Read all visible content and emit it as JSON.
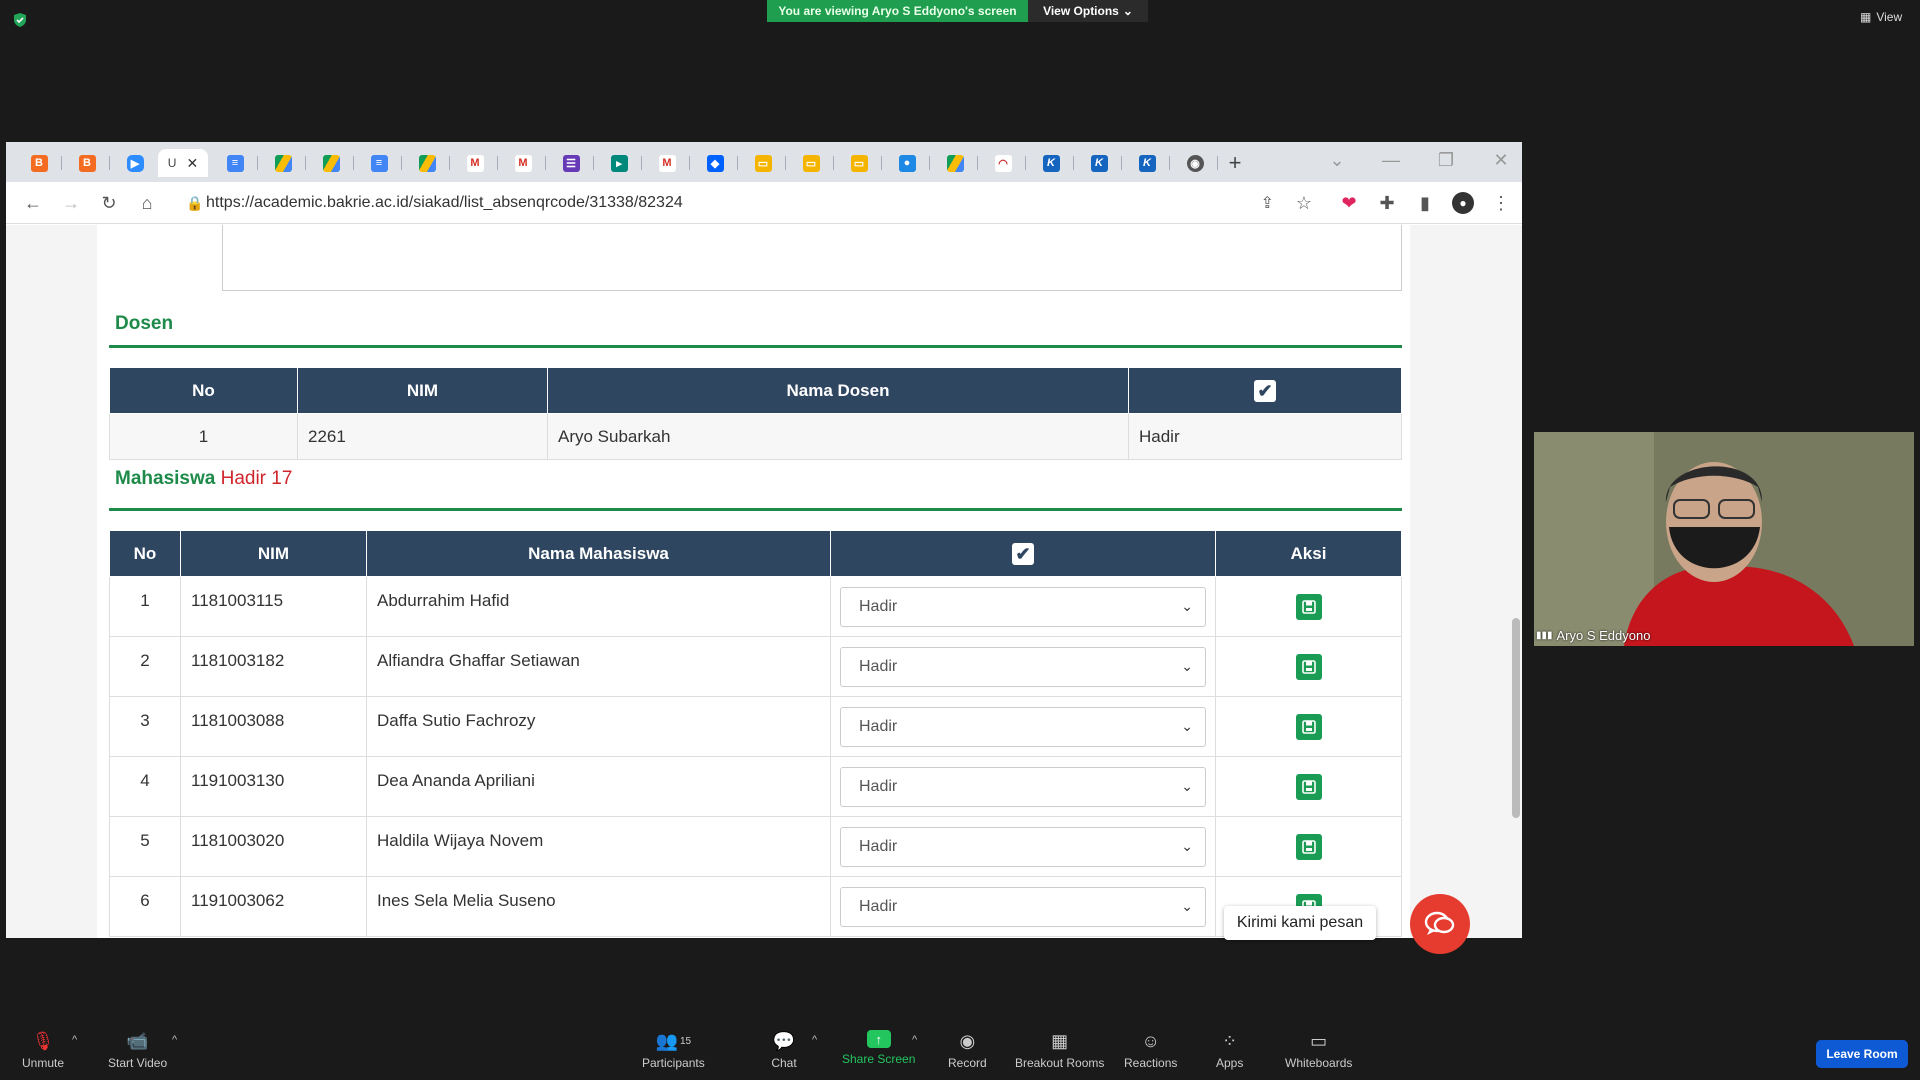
{
  "zoom": {
    "banner": "You are viewing Aryo S Eddyono's screen",
    "view_options": "View Options",
    "view_label": "View",
    "participant_name": "Aryo S Eddyono",
    "participants_count": "15",
    "controls": [
      "Unmute",
      "Start Video",
      "Participants",
      "Chat",
      "Share Screen",
      "Record",
      "Breakout Rooms",
      "Reactions",
      "Apps",
      "Whiteboards"
    ],
    "leave": "Leave Room"
  },
  "browser": {
    "url": "https://academic.bakrie.ac.id/siakad/list_absenqrcode/31338/82324",
    "tab_favicons": [
      "brave",
      "brave",
      "zoom",
      "blank",
      "docs",
      "drive",
      "drive",
      "docs",
      "drive",
      "gmail",
      "gmail",
      "forms",
      "meet",
      "gmail",
      "dropbox",
      "slides",
      "slides",
      "slides",
      "classroom",
      "drive",
      "speed",
      "k",
      "k",
      "k",
      "chrome"
    ]
  },
  "page": {
    "dosen_title": "Dosen",
    "dosen_headers": [
      "No",
      "NIM",
      "Nama Dosen"
    ],
    "dosen_rows": [
      {
        "no": "1",
        "nim": "2261",
        "nama": "Aryo Subarkah",
        "status": "Hadir"
      }
    ],
    "mhs_title": "Mahasiswa",
    "mhs_hadir_label": "Hadir",
    "mhs_hadir_count": "17",
    "mhs_headers": [
      "No",
      "NIM",
      "Nama Mahasiswa",
      "Aksi"
    ],
    "mhs_rows": [
      {
        "no": "1",
        "nim": "1181003115",
        "nama": "Abdurrahim Hafid",
        "status": "Hadir"
      },
      {
        "no": "2",
        "nim": "1181003182",
        "nama": "Alfiandra Ghaffar Setiawan",
        "status": "Hadir"
      },
      {
        "no": "3",
        "nim": "1181003088",
        "nama": "Daffa Sutio Fachrozy",
        "status": "Hadir"
      },
      {
        "no": "4",
        "nim": "1191003130",
        "nama": "Dea Ananda Apriliani",
        "status": "Hadir"
      },
      {
        "no": "5",
        "nim": "1181003020",
        "nama": "Haldila Wijaya Novem",
        "status": "Hadir"
      },
      {
        "no": "6",
        "nim": "1191003062",
        "nama": "Ines Sela Melia Suseno",
        "status": "Hadir"
      }
    ],
    "chat_prompt": "Kirimi kami pesan"
  },
  "colors": {
    "accent_green": "#1e8a4a",
    "header_navy": "#2f4661",
    "hadir_red": "#d0262b"
  }
}
